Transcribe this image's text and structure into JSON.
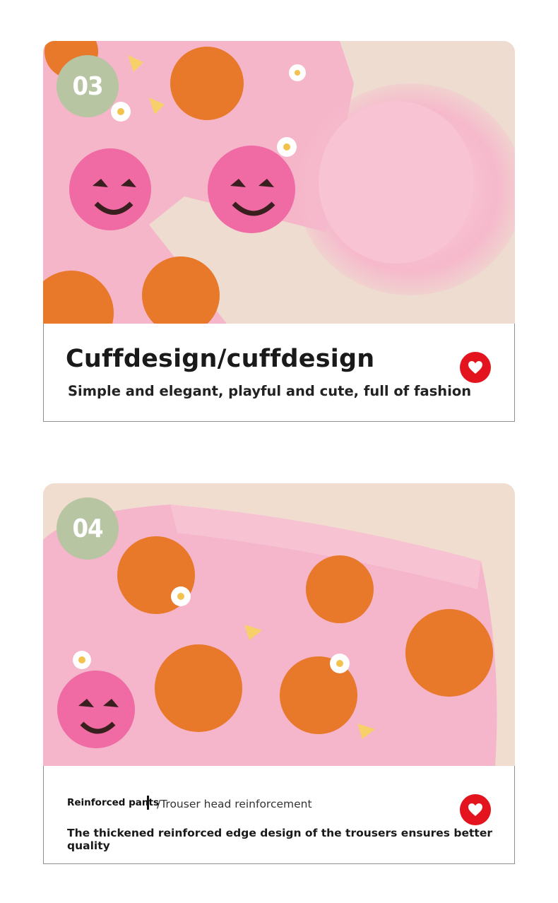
{
  "sections": [
    {
      "badge": "03",
      "title": "Cuffdesign/cuffdesign",
      "subtitle": "Simple and elegant, playful and cute, full of fashion",
      "heart_color": "#e3141d"
    },
    {
      "badge": "04",
      "label_bold": "Reinforced pants",
      "label_regular": "/Trouser head reinforcement",
      "description": "The thickened reinforced edge design of the trousers ensures better quality",
      "heart_color": "#e3141d"
    }
  ],
  "colors": {
    "badge_bg": "#b7c5a3",
    "fabric_pink": "#f5b8cc",
    "pumpkin_orange": "#e8782a",
    "feather_pink": "#f9c6d6",
    "backdrop": "#f0dccf"
  }
}
